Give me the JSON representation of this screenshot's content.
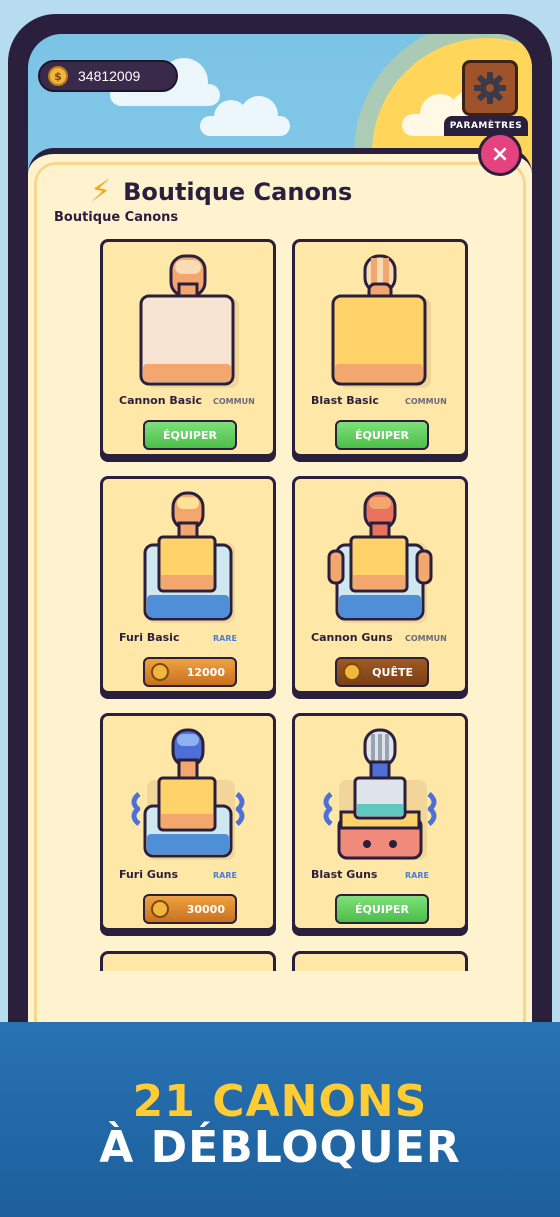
{
  "hud": {
    "coins": "34812009",
    "coin_symbol": "$",
    "settings_label": "PARAMÈTRES",
    "close_symbol": "×"
  },
  "shop": {
    "title": "Boutique Canons",
    "subtitle": "Boutique Canons",
    "title_icon": "⚡",
    "items": [
      {
        "name": "Cannon Basic",
        "rarity": "COMMUN",
        "button": "ÉQUIPER",
        "button_type": "equip"
      },
      {
        "name": "Blast Basic",
        "rarity": "COMMUN",
        "button": "ÉQUIPER",
        "button_type": "equip"
      },
      {
        "name": "Furi Basic",
        "rarity": "RARE",
        "button": "12000",
        "button_type": "price"
      },
      {
        "name": "Cannon Guns",
        "rarity": "COMMUN",
        "button": "QUÊTE",
        "button_type": "quest"
      },
      {
        "name": "Furi Guns",
        "rarity": "RARE",
        "button": "30000",
        "button_type": "price"
      },
      {
        "name": "Blast Guns",
        "rarity": "RARE",
        "button": "ÉQUIPER",
        "button_type": "equip"
      }
    ]
  },
  "banner": {
    "line1": "21 CANONS",
    "line2": "À DÉBLOQUER"
  },
  "colors": {
    "accent_yellow": "#ffcc33",
    "banner_blue": "#2872b3",
    "equip_green": "#4cbe48",
    "price_orange": "#c9701f",
    "close_pink": "#e5437d"
  }
}
